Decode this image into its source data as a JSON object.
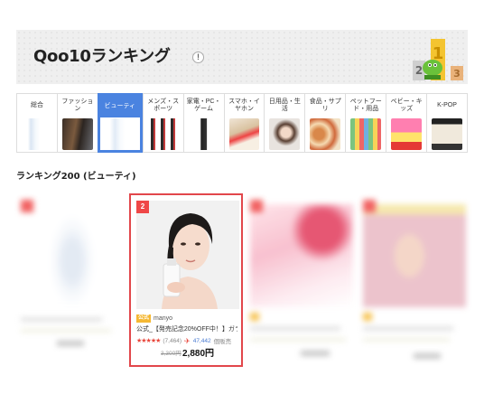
{
  "header": {
    "title": "Qoo10ランキング",
    "info_icon": "!"
  },
  "categories": [
    {
      "label": "総合",
      "active": false
    },
    {
      "label": "ファッション",
      "active": false
    },
    {
      "label": "ビューティ",
      "active": true
    },
    {
      "label": "メンズ・スポーツ",
      "active": false
    },
    {
      "label": "家電・PC・ゲーム",
      "active": false
    },
    {
      "label": "スマホ・イヤホン",
      "active": false
    },
    {
      "label": "日用品・生活",
      "active": false
    },
    {
      "label": "食品・サプリ",
      "active": false
    },
    {
      "label": "ペットフード・用品",
      "active": false
    },
    {
      "label": "ベビー・キッズ",
      "active": false
    },
    {
      "label": "K-POP",
      "active": false
    }
  ],
  "section_title": "ランキング200 (ビューティ)",
  "featured_product": {
    "rank": "2",
    "shop_badge": "公式",
    "shop_name": "manyo",
    "title": "公式_【発売記念20%OFF中！】ガラ…",
    "stars": "★★★★★",
    "review_count": "(7,464)",
    "sold_count": "47,442",
    "sold_label": "個販売",
    "old_price": "3,300円",
    "price": "2,880円"
  },
  "colors": {
    "accent_blue": "#4a83e0",
    "rank_red": "#ef4747",
    "featured_border": "#e2474b"
  }
}
